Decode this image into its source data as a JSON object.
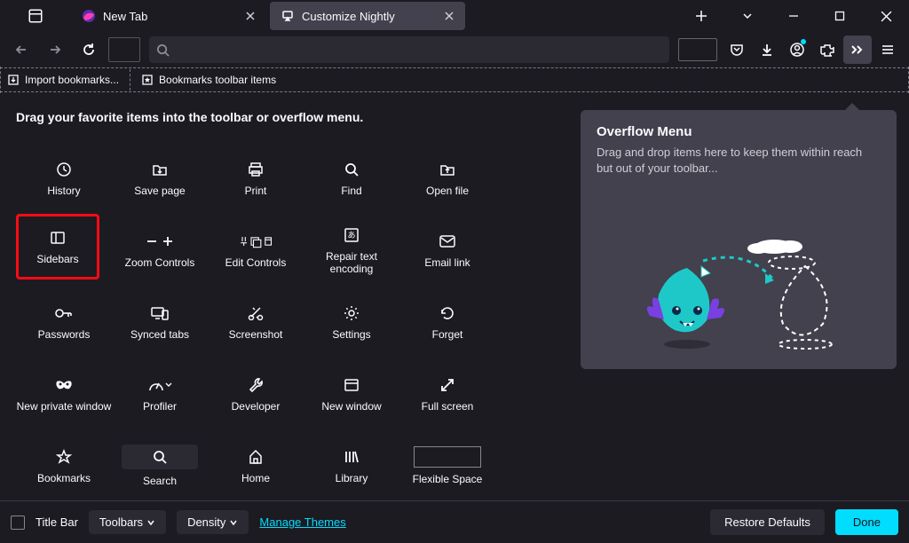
{
  "tabs": [
    {
      "label": "New Tab",
      "active": false
    },
    {
      "label": "Customize Nightly",
      "active": true
    }
  ],
  "bookmarks_bar": {
    "import": "Import bookmarks...",
    "items_label": "Bookmarks toolbar items"
  },
  "palette_heading": "Drag your favorite items into the toolbar or overflow menu.",
  "items": {
    "history": "History",
    "save_page": "Save page",
    "print": "Print",
    "find": "Find",
    "open_file": "Open file",
    "sidebars": "Sidebars",
    "zoom": "Zoom Controls",
    "edit": "Edit Controls",
    "repair": "Repair text encoding",
    "email": "Email link",
    "passwords": "Passwords",
    "synced_tabs": "Synced tabs",
    "screenshot": "Screenshot",
    "settings": "Settings",
    "forget": "Forget",
    "private": "New private window",
    "profiler": "Profiler",
    "developer": "Developer",
    "new_window": "New window",
    "full_screen": "Full screen",
    "bookmarks": "Bookmarks",
    "search": "Search",
    "home": "Home",
    "library": "Library",
    "flexible_space": "Flexible Space"
  },
  "overflow": {
    "title": "Overflow Menu",
    "desc": "Drag and drop items here to keep them within reach but out of your toolbar..."
  },
  "bottom": {
    "titlebar": "Title Bar",
    "toolbars": "Toolbars",
    "density": "Density",
    "manage_themes": "Manage Themes",
    "restore": "Restore Defaults",
    "done": "Done"
  }
}
